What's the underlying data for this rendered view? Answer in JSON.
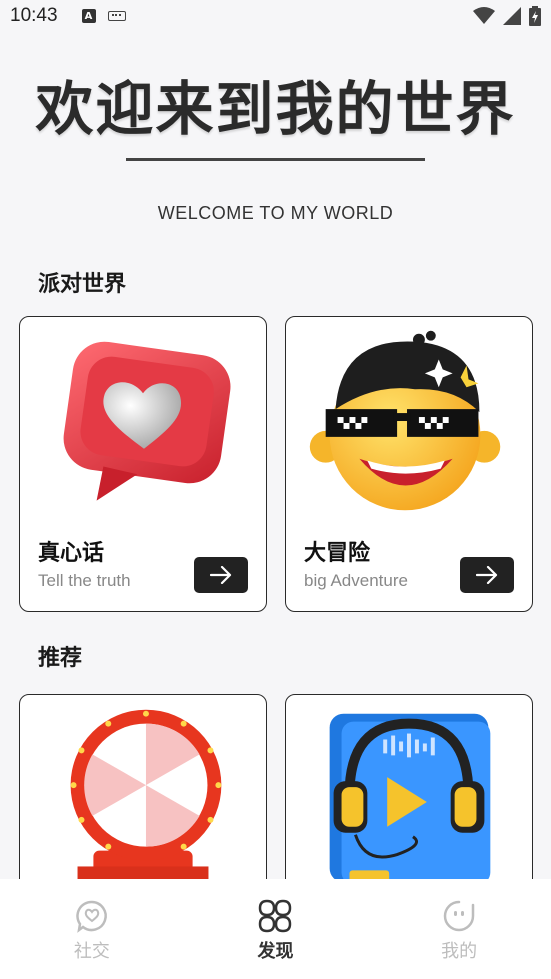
{
  "status_bar": {
    "time": "10:43",
    "left_icons": [
      "a-notification-icon",
      "keyboard-icon"
    ],
    "right_icons": [
      "wifi-icon",
      "signal-icon",
      "battery-icon"
    ]
  },
  "hero": {
    "title": "欢迎来到我的世界",
    "subtitle": "WELCOME TO MY WORLD"
  },
  "sections": {
    "party": {
      "title": "派对世界"
    },
    "recommend": {
      "title": "推荐"
    }
  },
  "cards": [
    {
      "title": "真心话",
      "subtitle": "Tell the truth",
      "art": "heart-chat-bubble-icon"
    },
    {
      "title": "大冒险",
      "subtitle": "big Adventure",
      "art": "cool-emoji-face-icon"
    },
    {
      "title": "",
      "subtitle": "",
      "art": "prize-wheel-icon"
    },
    {
      "title": "",
      "subtitle": "",
      "art": "headphones-book-icon"
    }
  ],
  "tabbar": {
    "items": [
      {
        "label": "社交",
        "icon": "chat-heart-icon",
        "active": false
      },
      {
        "label": "发现",
        "icon": "discover-grid-icon",
        "active": true
      },
      {
        "label": "我的",
        "icon": "face-bubble-icon",
        "active": false
      }
    ]
  },
  "colors": {
    "background": "#f6f6f8",
    "card_border": "#2a2a2a",
    "button": "#222222",
    "tab_inactive": "#bdbdbd",
    "tab_active": "#333333"
  }
}
